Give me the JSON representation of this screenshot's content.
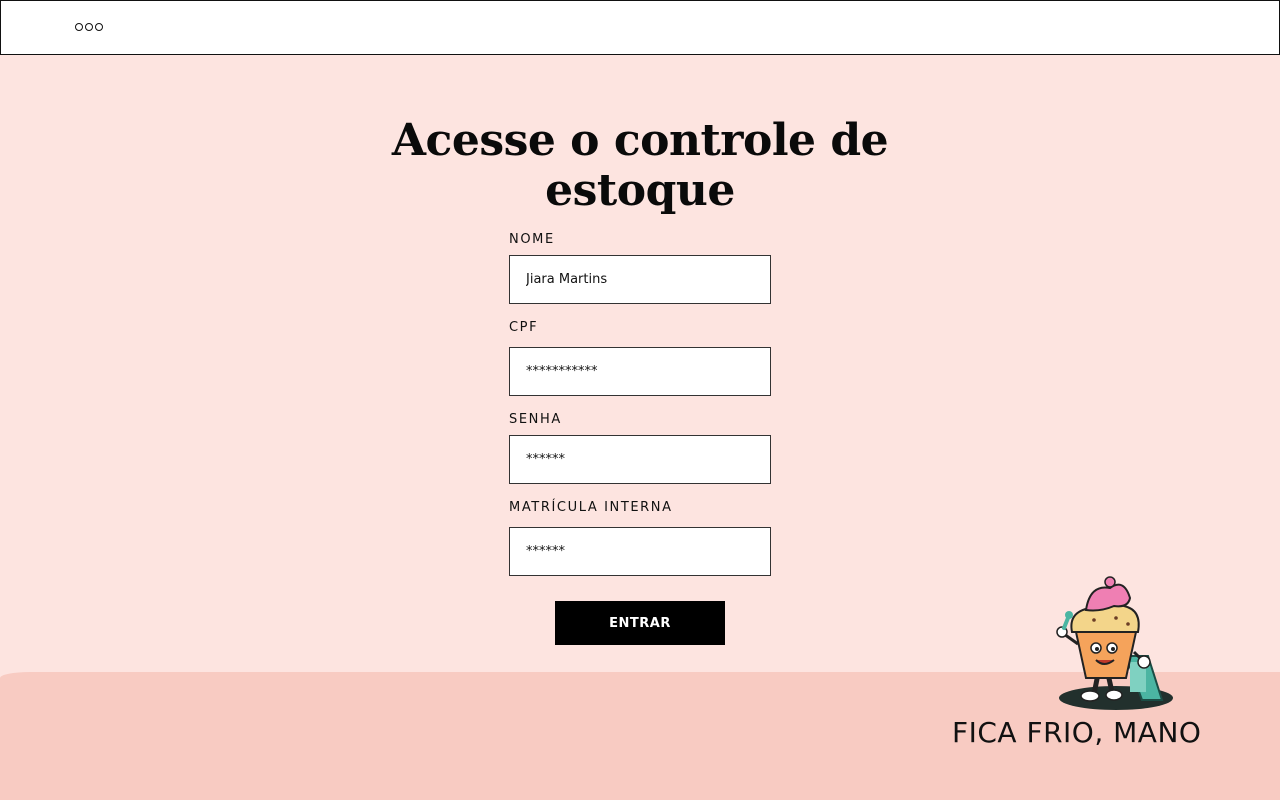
{
  "window": {
    "controls_icon": "ellipsis-dots-icon"
  },
  "title": {
    "line1": "Acesse o controle de",
    "line2": "estoque"
  },
  "form": {
    "nome": {
      "label": "NOME",
      "value": "Jiara Martins"
    },
    "cpf": {
      "label": "CPF",
      "value": "***********"
    },
    "senha": {
      "label": "SENHA",
      "value": "******"
    },
    "matricula": {
      "label": "MATRÍCULA INTERNA",
      "value": "******"
    },
    "submit_label": "ENTRAR"
  },
  "footer": {
    "slogan": "FICA FRIO, MANO",
    "mascot_icon": "ice-cream-mascot-icon",
    "band_color": "#f8cbc2"
  },
  "colors": {
    "background": "#fde4e0",
    "button": "#000000"
  }
}
